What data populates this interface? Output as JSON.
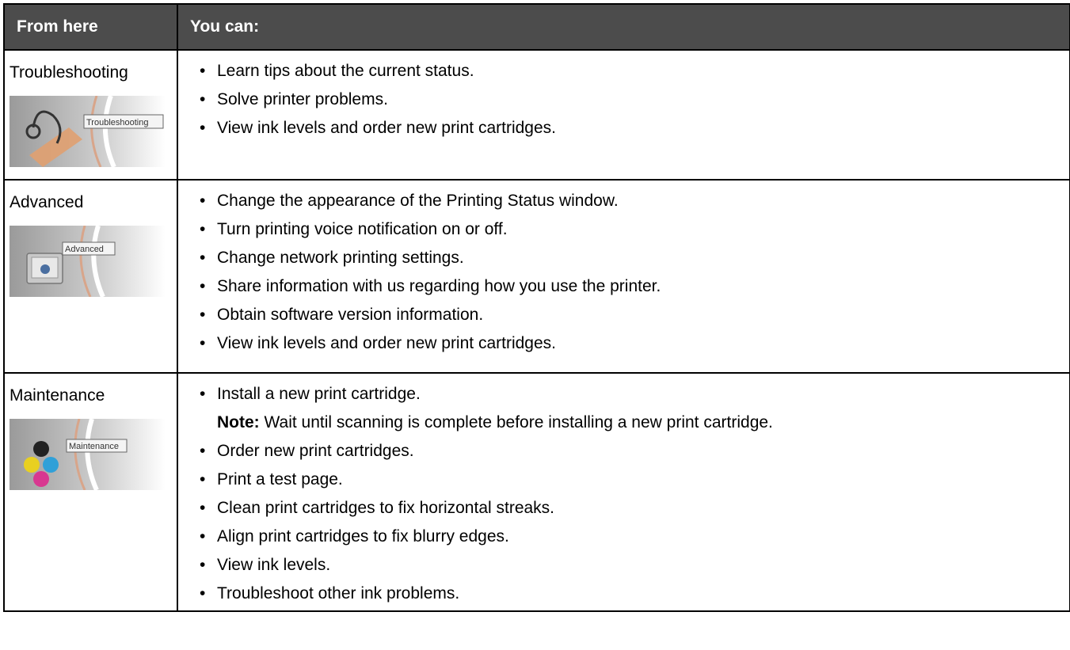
{
  "header": {
    "col1": "From here",
    "col2": "You can:"
  },
  "rows": [
    {
      "source": "Troubleshooting",
      "thumbnail_caption": "Troubleshooting",
      "actions": [
        "Learn tips about the current status.",
        "Solve printer problems.",
        "View ink levels and order new print cartridges."
      ]
    },
    {
      "source": "Advanced",
      "thumbnail_caption": "Advanced",
      "actions": [
        "Change the appearance of the Printing Status window.",
        "Turn printing voice notification on or off.",
        "Change network printing settings.",
        "Share information with us regarding how you use the printer.",
        "Obtain software version information.",
        "View ink levels and order new print cartridges."
      ]
    },
    {
      "source": "Maintenance",
      "thumbnail_caption": "Maintenance",
      "actions": [
        "Install a new print cartridge.",
        "Order new print cartridges.",
        "Print a test page.",
        "Clean print cartridges to fix horizontal streaks.",
        "Align print cartridges to fix blurry edges.",
        "View ink levels.",
        "Troubleshoot other ink problems."
      ],
      "note_label": "Note:",
      "note_text": " Wait until scanning is complete before installing a new print cartridge."
    }
  ],
  "bullet_char": "•",
  "colors": {
    "header_bg": "#4c4c4c",
    "header_text": "#ffffff",
    "border": "#000000"
  }
}
